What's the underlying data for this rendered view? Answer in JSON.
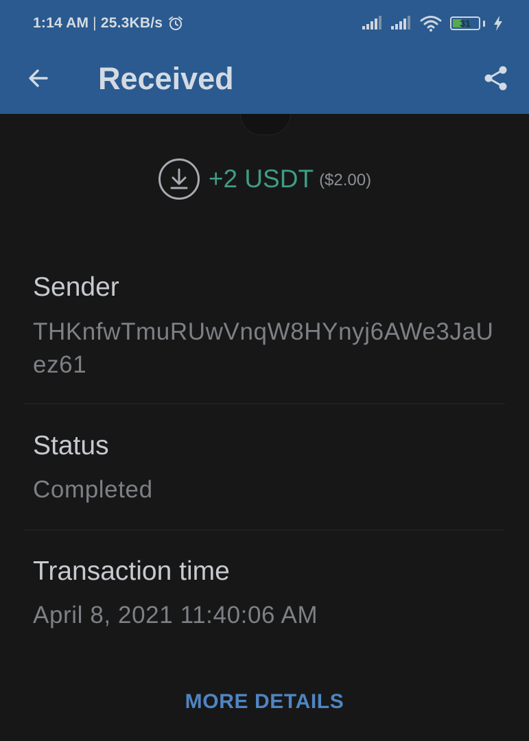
{
  "status_bar": {
    "time": "1:14 AM",
    "separator": "|",
    "speed": "25.3KB/s",
    "battery_level": "31",
    "icons": [
      "alarm-icon",
      "signal-icon",
      "signal-icon",
      "wifi-icon",
      "battery-icon",
      "charging-bolt-icon"
    ]
  },
  "app_bar": {
    "title": "Received",
    "back_icon": "arrow-left-icon",
    "share_icon": "share-icon"
  },
  "transaction": {
    "direction_icon": "download-circle-icon",
    "amount": "+2 USDT",
    "fiat_amount": "($2.00)"
  },
  "details": [
    {
      "label": "Sender",
      "value": "THKnfwTmuRUwVnqW8HYnyj6AWe3JaUez61"
    },
    {
      "label": "Status",
      "value": "Completed"
    },
    {
      "label": "Transaction time",
      "value": "April 8, 2021 11:40:06 AM"
    }
  ],
  "actions": {
    "more_details_label": "MORE DETAILS"
  },
  "colors": {
    "header_bg": "#2a5a8f",
    "page_bg": "#171718",
    "amount": "#3f9d84",
    "link": "#4f85c2"
  }
}
